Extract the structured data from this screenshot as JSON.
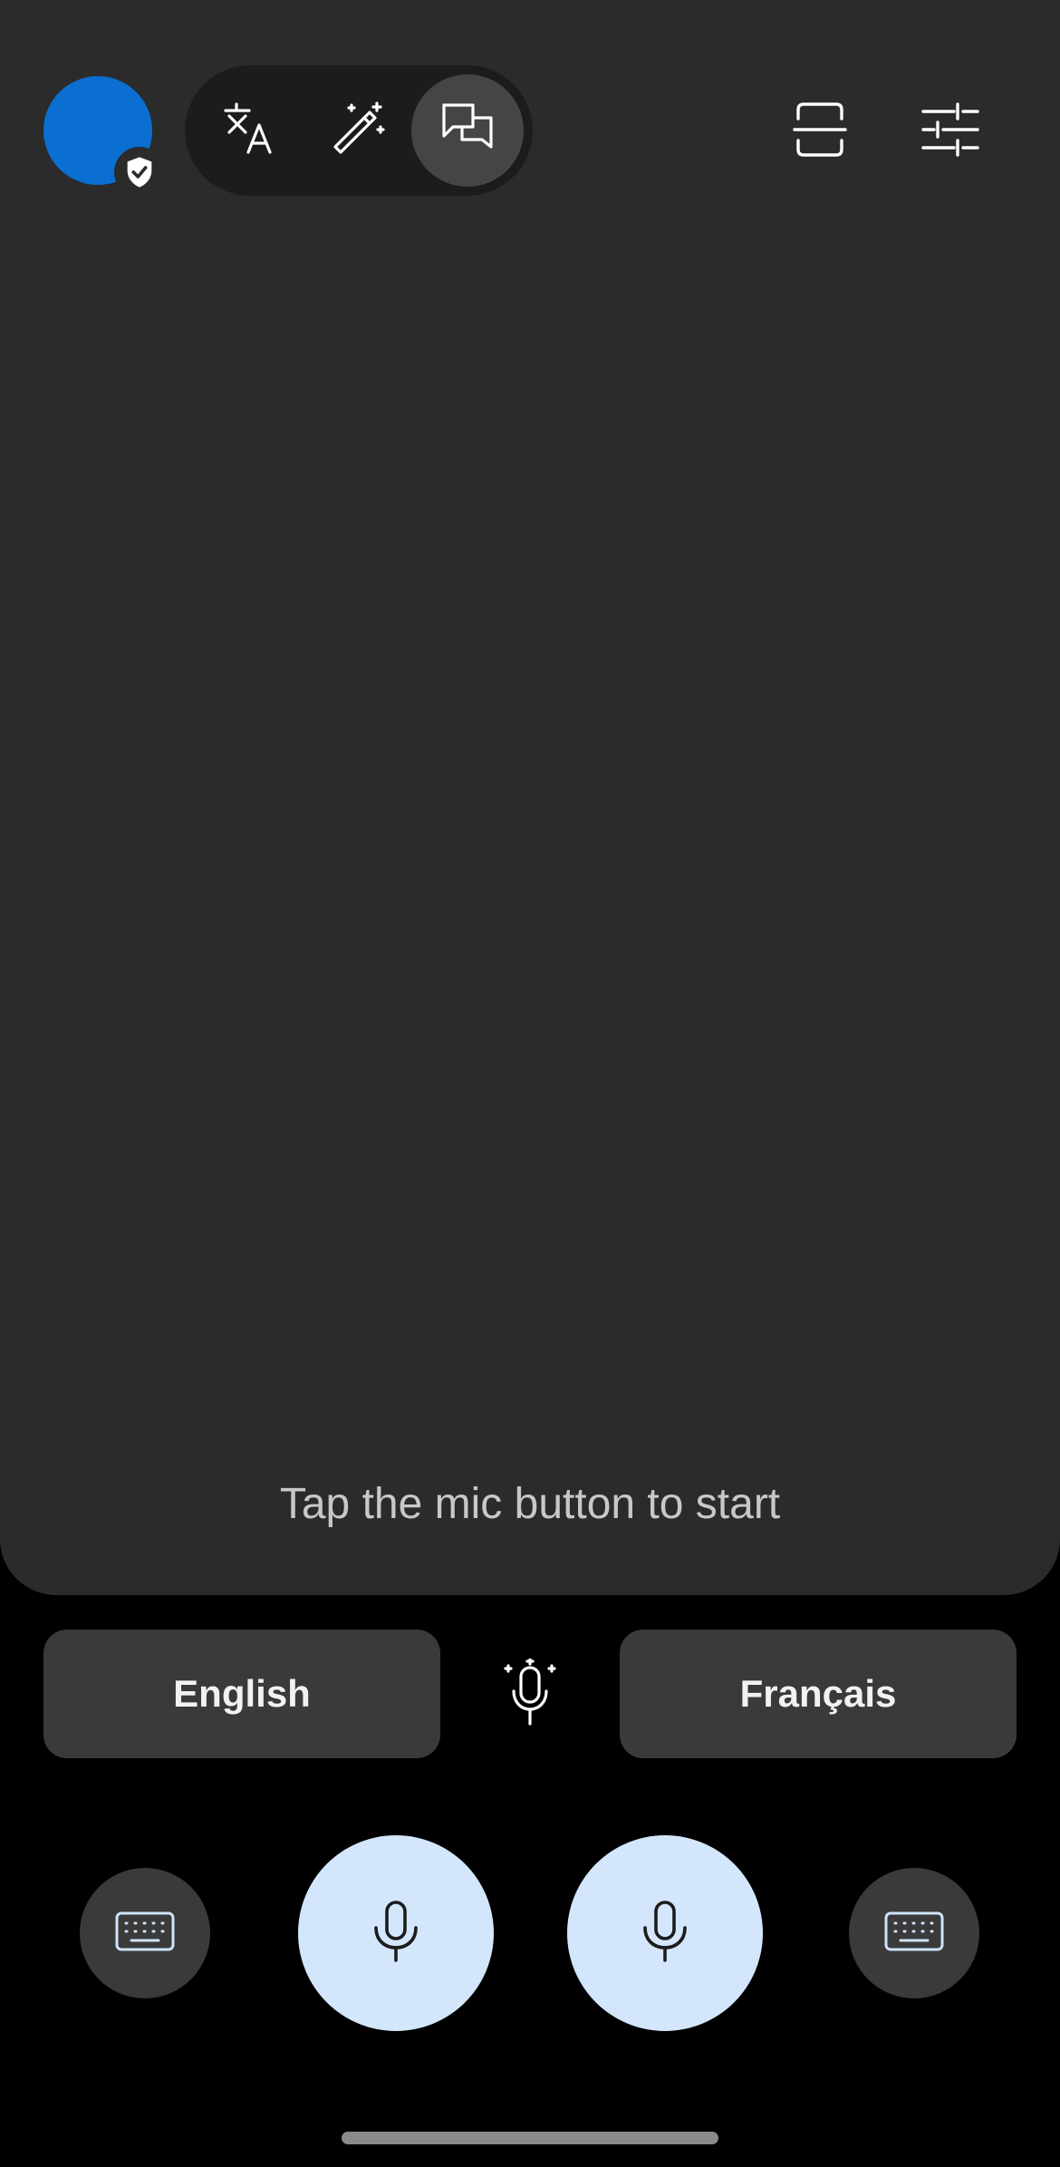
{
  "header": {
    "modes": [
      {
        "icon": "translate-icon",
        "active": false
      },
      {
        "icon": "magic-pen-icon",
        "active": false
      },
      {
        "icon": "conversation-icon",
        "active": true
      }
    ],
    "right_icons": [
      "scan-icon",
      "settings-sliders-icon"
    ],
    "avatar_badge_icon": "shield-check-icon"
  },
  "main": {
    "hint": "Tap the mic button to start"
  },
  "languages": {
    "left": "English",
    "right": "Français",
    "auto_mic_icon": "auto-detect-mic-icon"
  },
  "controls": {
    "left_keyboard_icon": "keyboard-icon",
    "left_mic_icon": "mic-icon",
    "right_mic_icon": "mic-icon",
    "right_keyboard_icon": "keyboard-icon"
  },
  "colors": {
    "avatar": "#0a6fd1",
    "panel": "#2b2b2b",
    "background": "#000000",
    "mic_button": "#d3e6fb",
    "language_button": "#3a3a3a"
  }
}
